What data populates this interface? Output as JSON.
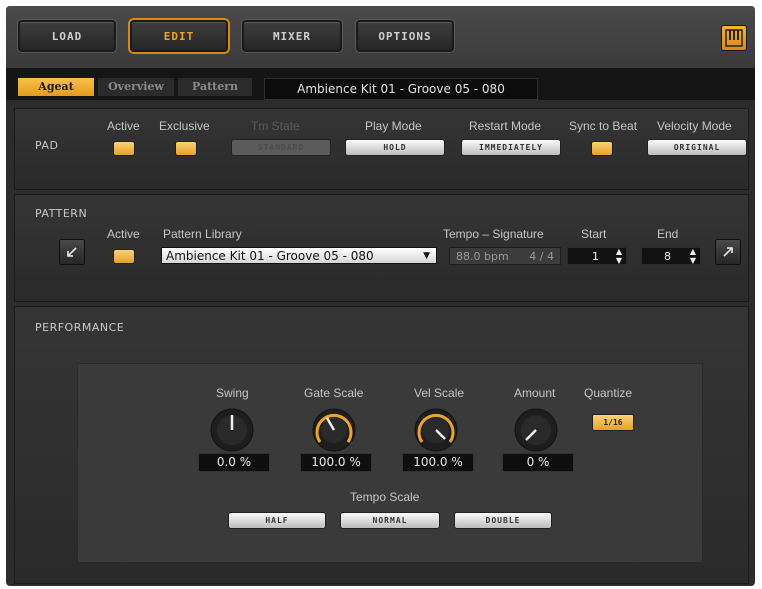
{
  "topbar": {
    "buttons": [
      {
        "label": "LOAD"
      },
      {
        "label": "EDIT",
        "active": true
      },
      {
        "label": "MIXER"
      },
      {
        "label": "OPTIONS"
      }
    ]
  },
  "tabs": [
    {
      "label": "Ageat",
      "active": true
    },
    {
      "label": "Overview"
    },
    {
      "label": "Pattern"
    }
  ],
  "preset_title": "Ambience Kit 01 - Groove 05 - 080",
  "pad": {
    "title": "PAD",
    "active_label": "Active",
    "exclusive_label": "Exclusive",
    "trim_label": "Tm State",
    "trim_value": "STANDARD",
    "play_mode_label": "Play Mode",
    "play_mode_value": "HOLD",
    "restart_mode_label": "Restart Mode",
    "restart_mode_value": "IMMEDIATELY",
    "sync_label": "Sync to Beat",
    "velocity_mode_label": "Velocity Mode",
    "velocity_mode_value": "ORIGINAL"
  },
  "pattern": {
    "title": "PATTERN",
    "active_label": "Active",
    "library_label": "Pattern Library",
    "library_value": "Ambience Kit 01 - Groove 05 - 080",
    "tempo_label": "Tempo – Signature",
    "tempo_value": "88.0 bpm",
    "signature_value": "4 / 4",
    "start_label": "Start",
    "start_value": "1",
    "end_label": "End",
    "end_value": "8"
  },
  "performance": {
    "title": "PERFORMANCE",
    "swing_label": "Swing",
    "swing_value": "0.0 %",
    "gate_label": "Gate Scale",
    "gate_value": "100.0 %",
    "vel_label": "Vel Scale",
    "vel_value": "100.0 %",
    "amount_label": "Amount",
    "amount_value": "0 %",
    "quantize_label": "Quantize",
    "quantize_value": "1/16",
    "tempo_scale_label": "Tempo Scale",
    "tempo_half": "HALF",
    "tempo_normal": "NORMAL",
    "tempo_double": "DOUBLE"
  },
  "colors": {
    "accent": "#e8a62a",
    "panel": "#2c2c2c"
  }
}
